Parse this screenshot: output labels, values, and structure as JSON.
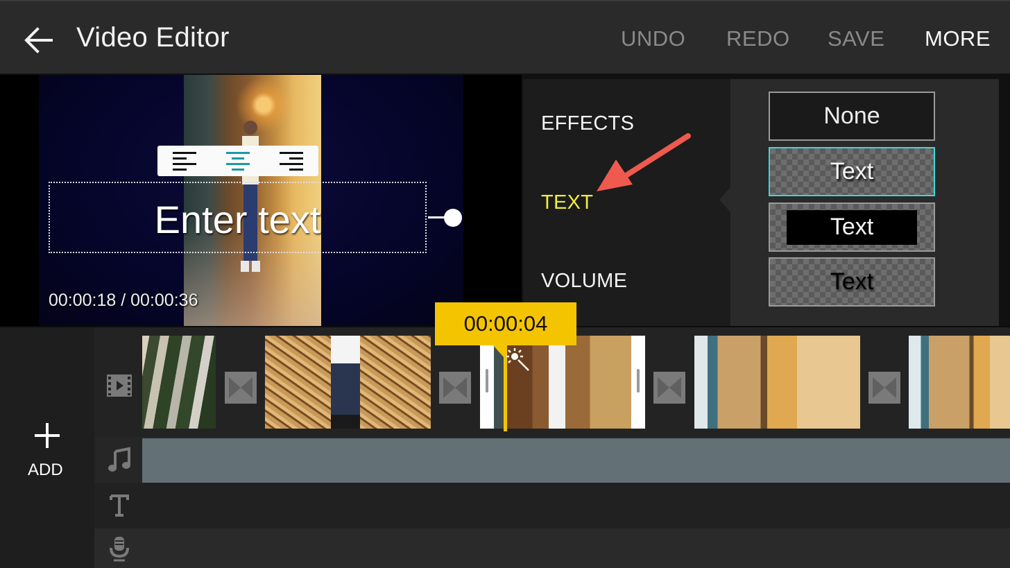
{
  "header": {
    "title": "Video Editor",
    "actions": {
      "undo": "UNDO",
      "redo": "REDO",
      "save": "SAVE",
      "more": "MORE"
    }
  },
  "preview": {
    "text_overlay": "Enter text",
    "current_time": "00:00:18",
    "separator": "/",
    "total_time": "00:00:36",
    "timecode": "00:00:18 / 00:00:36",
    "alignment": {
      "options": [
        "left",
        "center",
        "right"
      ],
      "selected": "center"
    }
  },
  "menu": {
    "items": [
      {
        "label": "EFFECTS",
        "selected": false
      },
      {
        "label": "TEXT",
        "selected": true
      },
      {
        "label": "VOLUME",
        "selected": false
      }
    ],
    "text_styles": [
      {
        "label": "None",
        "style": "none",
        "selected": false
      },
      {
        "label": "Text",
        "style": "shadow",
        "selected": true
      },
      {
        "label": "Text",
        "style": "boxed",
        "selected": false
      },
      {
        "label": "Text",
        "style": "dark",
        "selected": false
      }
    ]
  },
  "timeline": {
    "add_label": "ADD",
    "playhead_time": "00:00:04",
    "tracks": [
      "video",
      "audio",
      "text",
      "voice"
    ],
    "clip_count": 5,
    "transition_count": 4
  },
  "colors": {
    "accent_yellow": "#f5c400",
    "selected_menu": "#f2ef3a",
    "selected_style_border": "#3fd6d6",
    "align_selected": "#1a9aa6",
    "audio_track": "#637075"
  }
}
